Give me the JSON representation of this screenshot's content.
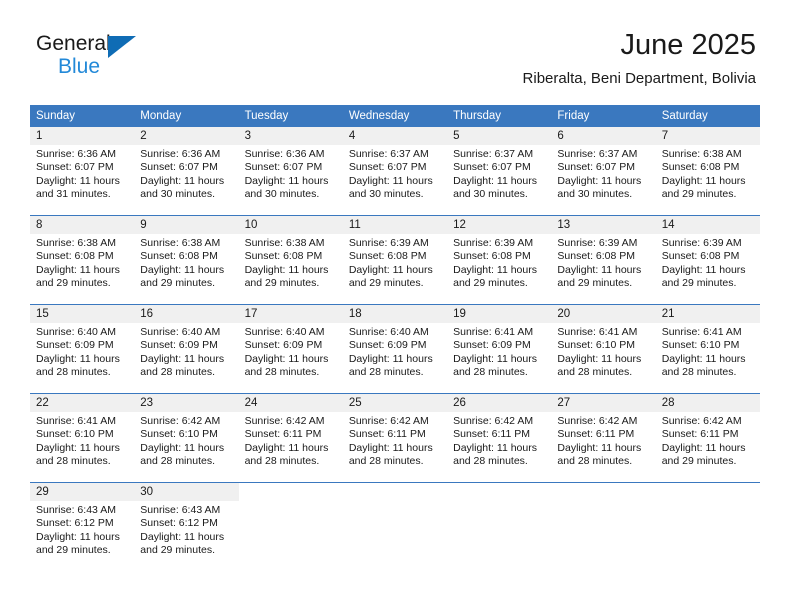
{
  "brand": {
    "name_top": "General",
    "name_bottom": "Blue",
    "triangle_color": "#0f6cb5",
    "blue_text_color": "#2389d8"
  },
  "header": {
    "title": "June 2025",
    "subtitle": "Riberalta, Beni Department, Bolivia"
  },
  "theme": {
    "header_blue": "#3a78bf",
    "daynum_band": "#f0f0f0",
    "text": "#1a1a1a"
  },
  "calendar": {
    "weekday_headers": [
      "Sunday",
      "Monday",
      "Tuesday",
      "Wednesday",
      "Thursday",
      "Friday",
      "Saturday"
    ],
    "weeks": [
      [
        {
          "day": "1",
          "sunrise": "Sunrise: 6:36 AM",
          "sunset": "Sunset: 6:07 PM",
          "daylight1": "Daylight: 11 hours",
          "daylight2": "and 31 minutes."
        },
        {
          "day": "2",
          "sunrise": "Sunrise: 6:36 AM",
          "sunset": "Sunset: 6:07 PM",
          "daylight1": "Daylight: 11 hours",
          "daylight2": "and 30 minutes."
        },
        {
          "day": "3",
          "sunrise": "Sunrise: 6:36 AM",
          "sunset": "Sunset: 6:07 PM",
          "daylight1": "Daylight: 11 hours",
          "daylight2": "and 30 minutes."
        },
        {
          "day": "4",
          "sunrise": "Sunrise: 6:37 AM",
          "sunset": "Sunset: 6:07 PM",
          "daylight1": "Daylight: 11 hours",
          "daylight2": "and 30 minutes."
        },
        {
          "day": "5",
          "sunrise": "Sunrise: 6:37 AM",
          "sunset": "Sunset: 6:07 PM",
          "daylight1": "Daylight: 11 hours",
          "daylight2": "and 30 minutes."
        },
        {
          "day": "6",
          "sunrise": "Sunrise: 6:37 AM",
          "sunset": "Sunset: 6:07 PM",
          "daylight1": "Daylight: 11 hours",
          "daylight2": "and 30 minutes."
        },
        {
          "day": "7",
          "sunrise": "Sunrise: 6:38 AM",
          "sunset": "Sunset: 6:08 PM",
          "daylight1": "Daylight: 11 hours",
          "daylight2": "and 29 minutes."
        }
      ],
      [
        {
          "day": "8",
          "sunrise": "Sunrise: 6:38 AM",
          "sunset": "Sunset: 6:08 PM",
          "daylight1": "Daylight: 11 hours",
          "daylight2": "and 29 minutes."
        },
        {
          "day": "9",
          "sunrise": "Sunrise: 6:38 AM",
          "sunset": "Sunset: 6:08 PM",
          "daylight1": "Daylight: 11 hours",
          "daylight2": "and 29 minutes."
        },
        {
          "day": "10",
          "sunrise": "Sunrise: 6:38 AM",
          "sunset": "Sunset: 6:08 PM",
          "daylight1": "Daylight: 11 hours",
          "daylight2": "and 29 minutes."
        },
        {
          "day": "11",
          "sunrise": "Sunrise: 6:39 AM",
          "sunset": "Sunset: 6:08 PM",
          "daylight1": "Daylight: 11 hours",
          "daylight2": "and 29 minutes."
        },
        {
          "day": "12",
          "sunrise": "Sunrise: 6:39 AM",
          "sunset": "Sunset: 6:08 PM",
          "daylight1": "Daylight: 11 hours",
          "daylight2": "and 29 minutes."
        },
        {
          "day": "13",
          "sunrise": "Sunrise: 6:39 AM",
          "sunset": "Sunset: 6:08 PM",
          "daylight1": "Daylight: 11 hours",
          "daylight2": "and 29 minutes."
        },
        {
          "day": "14",
          "sunrise": "Sunrise: 6:39 AM",
          "sunset": "Sunset: 6:08 PM",
          "daylight1": "Daylight: 11 hours",
          "daylight2": "and 29 minutes."
        }
      ],
      [
        {
          "day": "15",
          "sunrise": "Sunrise: 6:40 AM",
          "sunset": "Sunset: 6:09 PM",
          "daylight1": "Daylight: 11 hours",
          "daylight2": "and 28 minutes."
        },
        {
          "day": "16",
          "sunrise": "Sunrise: 6:40 AM",
          "sunset": "Sunset: 6:09 PM",
          "daylight1": "Daylight: 11 hours",
          "daylight2": "and 28 minutes."
        },
        {
          "day": "17",
          "sunrise": "Sunrise: 6:40 AM",
          "sunset": "Sunset: 6:09 PM",
          "daylight1": "Daylight: 11 hours",
          "daylight2": "and 28 minutes."
        },
        {
          "day": "18",
          "sunrise": "Sunrise: 6:40 AM",
          "sunset": "Sunset: 6:09 PM",
          "daylight1": "Daylight: 11 hours",
          "daylight2": "and 28 minutes."
        },
        {
          "day": "19",
          "sunrise": "Sunrise: 6:41 AM",
          "sunset": "Sunset: 6:09 PM",
          "daylight1": "Daylight: 11 hours",
          "daylight2": "and 28 minutes."
        },
        {
          "day": "20",
          "sunrise": "Sunrise: 6:41 AM",
          "sunset": "Sunset: 6:10 PM",
          "daylight1": "Daylight: 11 hours",
          "daylight2": "and 28 minutes."
        },
        {
          "day": "21",
          "sunrise": "Sunrise: 6:41 AM",
          "sunset": "Sunset: 6:10 PM",
          "daylight1": "Daylight: 11 hours",
          "daylight2": "and 28 minutes."
        }
      ],
      [
        {
          "day": "22",
          "sunrise": "Sunrise: 6:41 AM",
          "sunset": "Sunset: 6:10 PM",
          "daylight1": "Daylight: 11 hours",
          "daylight2": "and 28 minutes."
        },
        {
          "day": "23",
          "sunrise": "Sunrise: 6:42 AM",
          "sunset": "Sunset: 6:10 PM",
          "daylight1": "Daylight: 11 hours",
          "daylight2": "and 28 minutes."
        },
        {
          "day": "24",
          "sunrise": "Sunrise: 6:42 AM",
          "sunset": "Sunset: 6:11 PM",
          "daylight1": "Daylight: 11 hours",
          "daylight2": "and 28 minutes."
        },
        {
          "day": "25",
          "sunrise": "Sunrise: 6:42 AM",
          "sunset": "Sunset: 6:11 PM",
          "daylight1": "Daylight: 11 hours",
          "daylight2": "and 28 minutes."
        },
        {
          "day": "26",
          "sunrise": "Sunrise: 6:42 AM",
          "sunset": "Sunset: 6:11 PM",
          "daylight1": "Daylight: 11 hours",
          "daylight2": "and 28 minutes."
        },
        {
          "day": "27",
          "sunrise": "Sunrise: 6:42 AM",
          "sunset": "Sunset: 6:11 PM",
          "daylight1": "Daylight: 11 hours",
          "daylight2": "and 28 minutes."
        },
        {
          "day": "28",
          "sunrise": "Sunrise: 6:42 AM",
          "sunset": "Sunset: 6:11 PM",
          "daylight1": "Daylight: 11 hours",
          "daylight2": "and 29 minutes."
        }
      ],
      [
        {
          "day": "29",
          "sunrise": "Sunrise: 6:43 AM",
          "sunset": "Sunset: 6:12 PM",
          "daylight1": "Daylight: 11 hours",
          "daylight2": "and 29 minutes."
        },
        {
          "day": "30",
          "sunrise": "Sunrise: 6:43 AM",
          "sunset": "Sunset: 6:12 PM",
          "daylight1": "Daylight: 11 hours",
          "daylight2": "and 29 minutes."
        },
        {
          "day": "",
          "sunrise": "",
          "sunset": "",
          "daylight1": "",
          "daylight2": ""
        },
        {
          "day": "",
          "sunrise": "",
          "sunset": "",
          "daylight1": "",
          "daylight2": ""
        },
        {
          "day": "",
          "sunrise": "",
          "sunset": "",
          "daylight1": "",
          "daylight2": ""
        },
        {
          "day": "",
          "sunrise": "",
          "sunset": "",
          "daylight1": "",
          "daylight2": ""
        },
        {
          "day": "",
          "sunrise": "",
          "sunset": "",
          "daylight1": "",
          "daylight2": ""
        }
      ]
    ]
  }
}
